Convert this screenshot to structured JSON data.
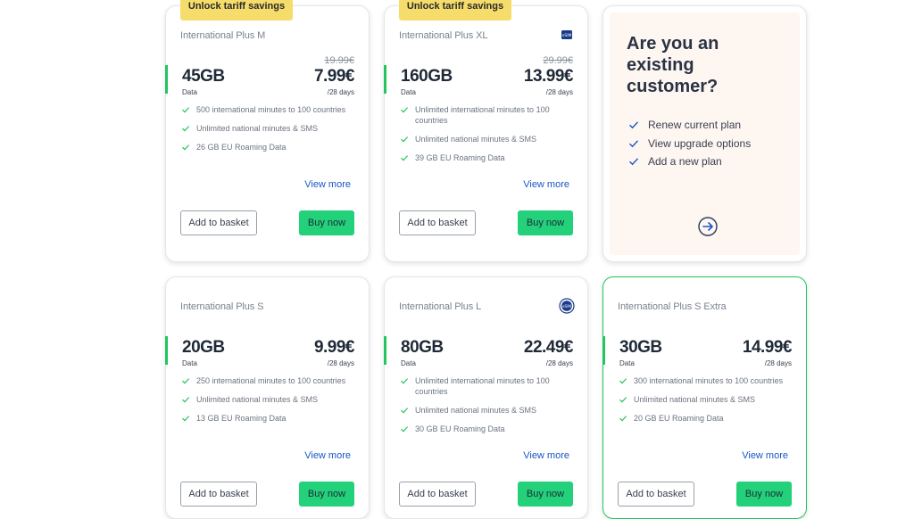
{
  "plans": [
    {
      "badge": "Unlock tariff savings",
      "name": "International Plus M",
      "esim": false,
      "data_amount": "45GB",
      "data_label": "Data",
      "old_price": "19.99€",
      "price": "7.99€",
      "period": "/28 days",
      "features": [
        "500 international minutes to 100 countries",
        "Unlimited national minutes & SMS",
        "26 GB EU Roaming Data"
      ],
      "view_more": "View more",
      "add_label": "Add to basket",
      "buy_label": "Buy now"
    },
    {
      "badge": "Unlock tariff savings",
      "name": "International Plus XL",
      "esim": true,
      "esim_text": "eSIM",
      "data_amount": "160GB",
      "data_label": "Data",
      "old_price": "29.99€",
      "price": "13.99€",
      "period": "/28 days",
      "features": [
        "Unlimited international minutes to 100 countries",
        "Unlimited national minutes & SMS",
        "39 GB EU Roaming Data"
      ],
      "view_more": "View more",
      "add_label": "Add to basket",
      "buy_label": "Buy now"
    },
    {
      "name": "International Plus S",
      "esim": false,
      "data_amount": "20GB",
      "data_label": "Data",
      "price": "9.99€",
      "period": "/28 days",
      "features": [
        "250 international minutes to 100 countries",
        "Unlimited national minutes & SMS",
        "13 GB EU Roaming Data"
      ],
      "view_more": "View more",
      "add_label": "Add to basket",
      "buy_label": "Buy now"
    },
    {
      "name": "International Plus L",
      "esim": true,
      "esim_text": "eSIM",
      "data_amount": "80GB",
      "data_label": "Data",
      "price": "22.49€",
      "period": "/28 days",
      "features": [
        "Unlimited international minutes to 100 countries",
        "Unlimited national minutes & SMS",
        "30 GB EU Roaming Data"
      ],
      "view_more": "View more",
      "add_label": "Add to basket",
      "buy_label": "Buy now"
    },
    {
      "name": "International Plus S Extra",
      "esim": false,
      "data_amount": "30GB",
      "data_label": "Data",
      "price": "14.99€",
      "period": "/28 days",
      "features": [
        "300 international minutes to 100 countries",
        "Unlimited national minutes & SMS",
        "20 GB EU Roaming Data"
      ],
      "view_more": "View more",
      "add_label": "Add to basket",
      "buy_label": "Buy now"
    }
  ],
  "existing": {
    "title": "Are you an existing customer?",
    "items": [
      "Renew current plan",
      "View upgrade options",
      "Add a new plan"
    ]
  },
  "icons": {
    "check": "check-icon",
    "arrow": "arrow-right-circle-icon",
    "esim": "esim-icon"
  },
  "colors": {
    "accent_green": "#22c55e",
    "buy_green": "#22d17a",
    "badge_yellow": "#f6dd6b",
    "link_blue": "#1a56c4",
    "existing_bg": "#fef6f1"
  }
}
